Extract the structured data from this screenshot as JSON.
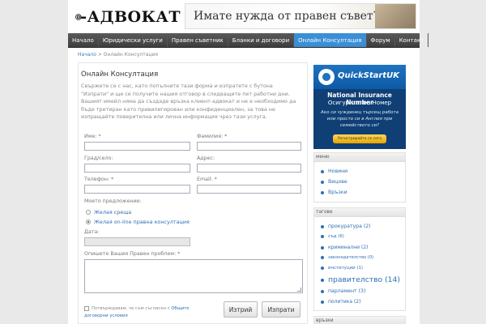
{
  "header": {
    "logo_text": "-АДВОКАТ",
    "banner_text": "Имате нужда от правен съвет?"
  },
  "nav": {
    "items": [
      {
        "label": "Начало"
      },
      {
        "label": "Юридически услуги"
      },
      {
        "label": "Правен съветник"
      },
      {
        "label": "Бланки и договори"
      },
      {
        "label": "Онлайн Консултация",
        "active": true
      },
      {
        "label": "Форум"
      },
      {
        "label": "Контакт"
      }
    ]
  },
  "breadcrumb": {
    "home": "Начало",
    "separator": ">",
    "current": "Онлайн Консултация"
  },
  "main": {
    "title": "Онлайн Консултация",
    "intro": "Свържете се с нас, като попълните тази форма и изпратете с бутона \"Изпрати\" и ще се получите нашия отговор в следващите пет работни дни. Вашият имейл няма да създаде връзка клиент-адвокат и не е необходимо да бъде третиран като привилигирован или конфиденциален, за това не изпращайте поверителна или лична информация чрез тази услуга."
  },
  "form": {
    "first_name_label": "Име: *",
    "last_name_label": "Фамилия: *",
    "city_label": "Град/село:",
    "address_label": "Адрес:",
    "phone_label": "Телефон: *",
    "email_label": "Email: *",
    "offer_label": "Моето предложение:",
    "options": [
      {
        "label": "Желая среща",
        "selected": false
      },
      {
        "label": "Желая on-line правна консултация",
        "selected": true
      }
    ],
    "date_label": "Дата:",
    "problem_label": "Опишете Вашия Правен проблем: *",
    "terms_text": "Потвърждавам, че съм съгласен с",
    "terms_link": "Общите договорни условия",
    "clear_button": "Изтрий",
    "submit_button": "Изпрати"
  },
  "ad": {
    "brand": "QuickStartUK",
    "line1": "National Insurance Number",
    "line2": "Осигурителен Номер",
    "line3": "Ако си чуждинец търсещ работа или простo си в Англия при семейството си?",
    "button": "Регистрирайте се сега"
  },
  "menu_widget": {
    "title": "меню",
    "items": [
      "Новини",
      "Вицове",
      "Връзки"
    ]
  },
  "tags_widget": {
    "title": "тагове",
    "items": [
      {
        "label": "прокуратура (2)",
        "size": 6.2
      },
      {
        "label": "съд (6)",
        "size": 5.4
      },
      {
        "label": "криминални (2)",
        "size": 6.0
      },
      {
        "label": "законодателство (0)",
        "size": 5.2
      },
      {
        "label": "институции (1)",
        "size": 5.4
      },
      {
        "label": "правителство (14)",
        "size": 9.2
      },
      {
        "label": "парламент (3)",
        "size": 6.2
      },
      {
        "label": "политика (2)",
        "size": 6.0
      }
    ]
  },
  "links_widget": {
    "title": "връзки"
  },
  "colors": {
    "accent": "#3a8fd6",
    "link": "#2f6fb3",
    "nav_bg": "#4a4a4a"
  }
}
